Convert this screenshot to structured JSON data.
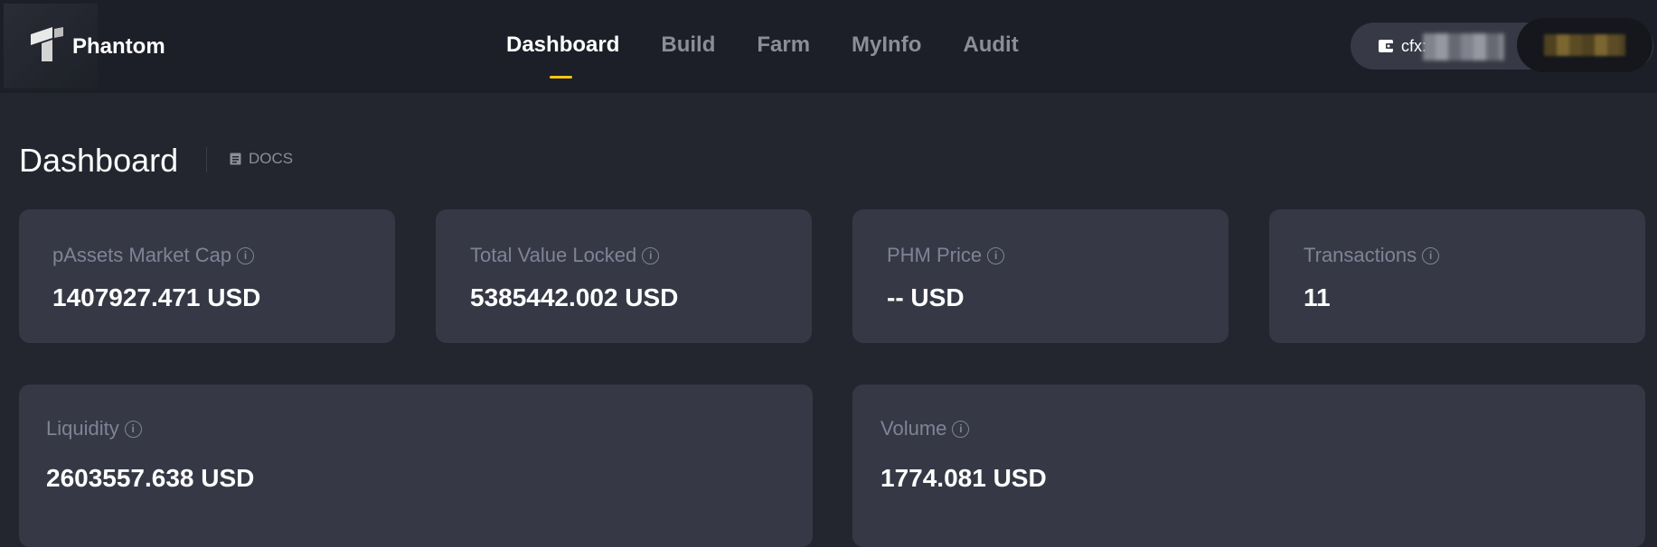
{
  "app": {
    "brand": "Phantom"
  },
  "nav": {
    "items": [
      {
        "label": "Dashboard",
        "active": true
      },
      {
        "label": "Build",
        "active": false
      },
      {
        "label": "Farm",
        "active": false
      },
      {
        "label": "MyInfo",
        "active": false
      },
      {
        "label": "Audit",
        "active": false
      }
    ]
  },
  "wallet": {
    "address_prefix": "cfx:",
    "icon": "wallet-icon"
  },
  "page": {
    "title": "Dashboard",
    "docs_label": "DOCS",
    "docs_icon": "document-icon"
  },
  "stats": [
    {
      "label": "pAssets Market Cap",
      "value": "1407927.471 USD"
    },
    {
      "label": "Total Value Locked",
      "value": "5385442.002 USD"
    },
    {
      "label": "PHM Price",
      "value": "-- USD"
    },
    {
      "label": "Transactions",
      "value": "11"
    }
  ],
  "panels": [
    {
      "label": "Liquidity",
      "value": "2603557.638 USD"
    },
    {
      "label": "Volume",
      "value": "1774.081 USD"
    }
  ],
  "colors": {
    "background": "#24262f",
    "topbar": "#1c1f27",
    "card": "#363945",
    "accent": "#f5c518",
    "muted": "#7f8396"
  }
}
